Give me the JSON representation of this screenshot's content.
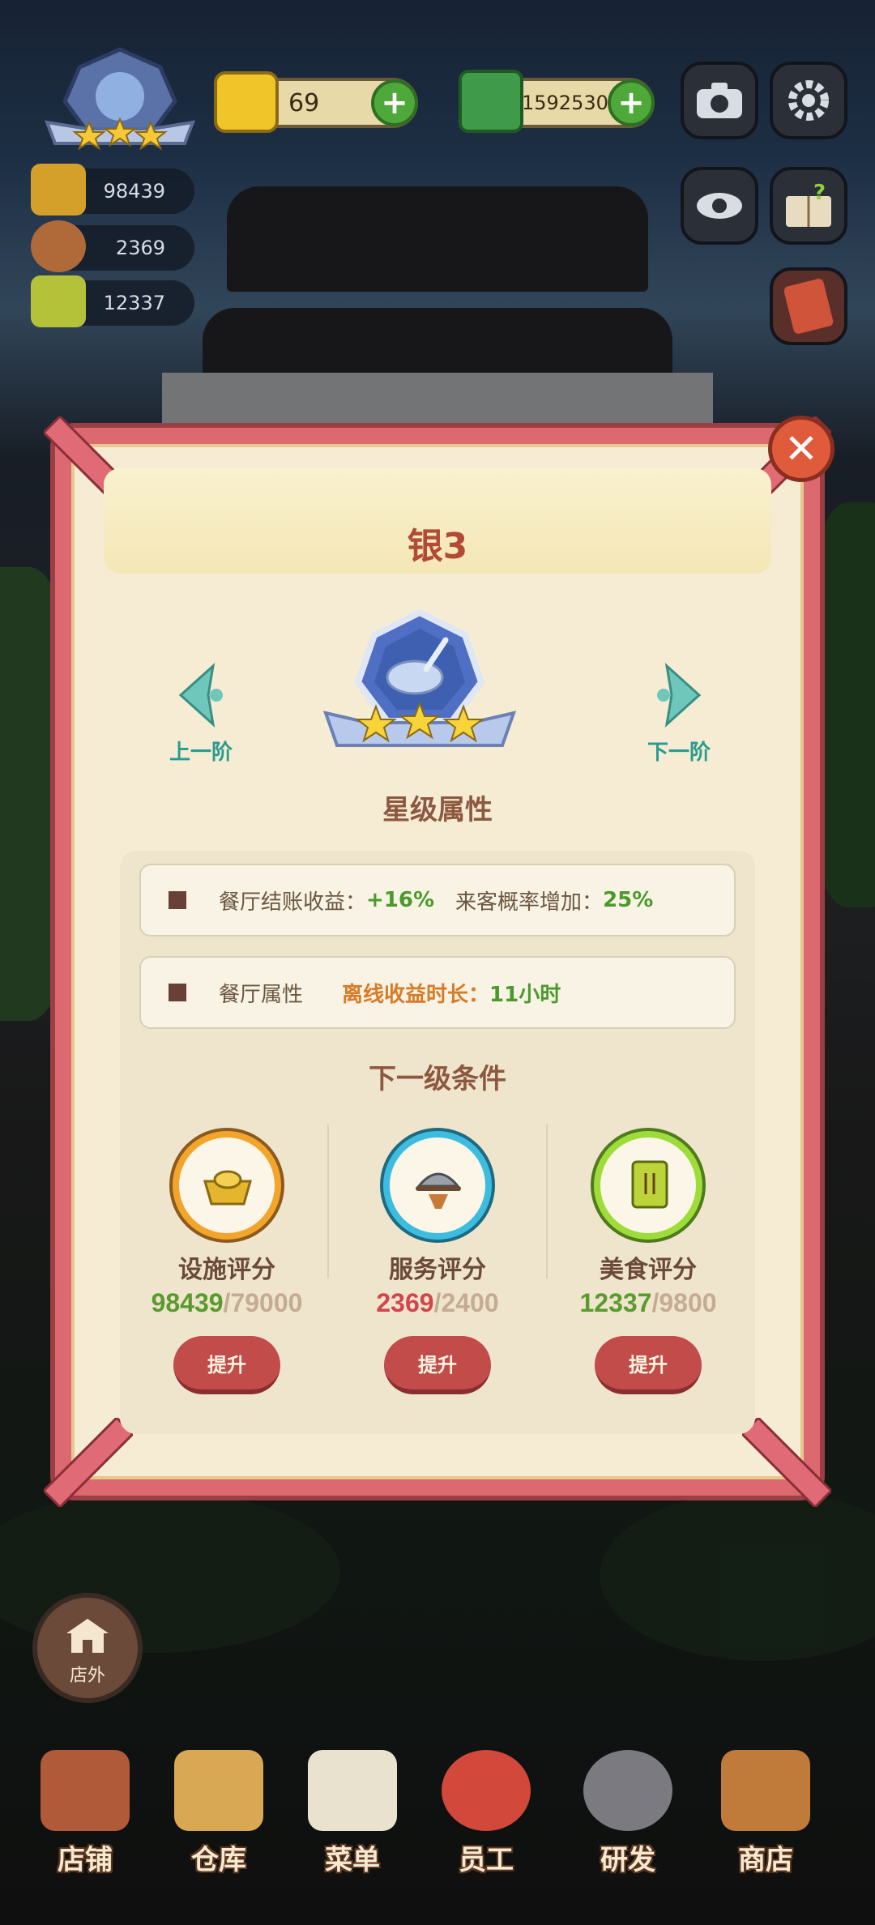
{
  "hud": {
    "gems": "69",
    "cash": "15925303",
    "facility_score": "98439",
    "service_score": "2369",
    "food_score": "12337"
  },
  "dialog": {
    "title": "银3",
    "prev_label": "上一阶",
    "next_label": "下一阶",
    "star_attr_heading": "星级属性",
    "attr1_label": "餐厅结账收益：",
    "attr1_value": "+16%",
    "attr1_label2": "来客概率增加：",
    "attr1_value2": "25%",
    "attr2_label": "餐厅属性",
    "attr2_key": "离线收益时长：",
    "attr2_value": "11小时",
    "next_level_heading": "下一级条件",
    "requirements": [
      {
        "name": "设施评分",
        "current": "98439",
        "target": "/79000",
        "button": "提升",
        "color": "#5a9a2f"
      },
      {
        "name": "服务评分",
        "current": "2369",
        "target": "/2400",
        "button": "提升",
        "color": "#d0464e"
      },
      {
        "name": "美食评分",
        "current": "12337",
        "target": "/9800",
        "button": "提升",
        "color": "#5a9a2f"
      }
    ]
  },
  "bottom": {
    "outside_label": "店外",
    "nav": [
      "店铺",
      "仓库",
      "菜单",
      "员工",
      "研发",
      "商店"
    ]
  }
}
